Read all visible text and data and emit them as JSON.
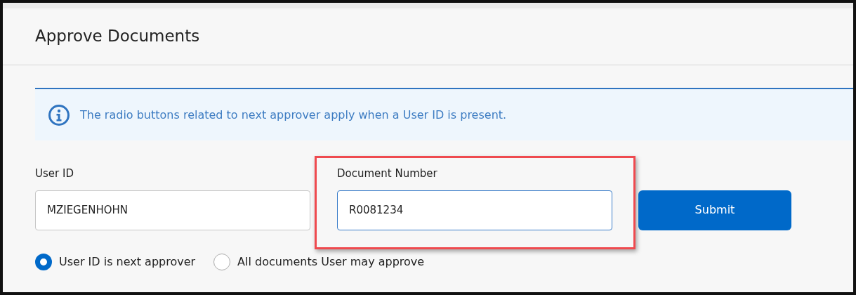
{
  "panel": {
    "title": "Approve Documents"
  },
  "alert": {
    "text": "The radio buttons related to next approver apply when a User ID is present."
  },
  "fields": [
    {
      "label": "User ID",
      "value": "MZIEGENHOHN",
      "focused": false,
      "highlighted": false
    },
    {
      "label": "Document Number",
      "value": "R0081234",
      "focused": true,
      "highlighted": true
    }
  ],
  "submit_button": {
    "label": "Submit"
  },
  "radios": [
    {
      "label": "User ID is next approver",
      "selected": true
    },
    {
      "label": "All documents User may approve",
      "selected": false
    }
  ]
}
